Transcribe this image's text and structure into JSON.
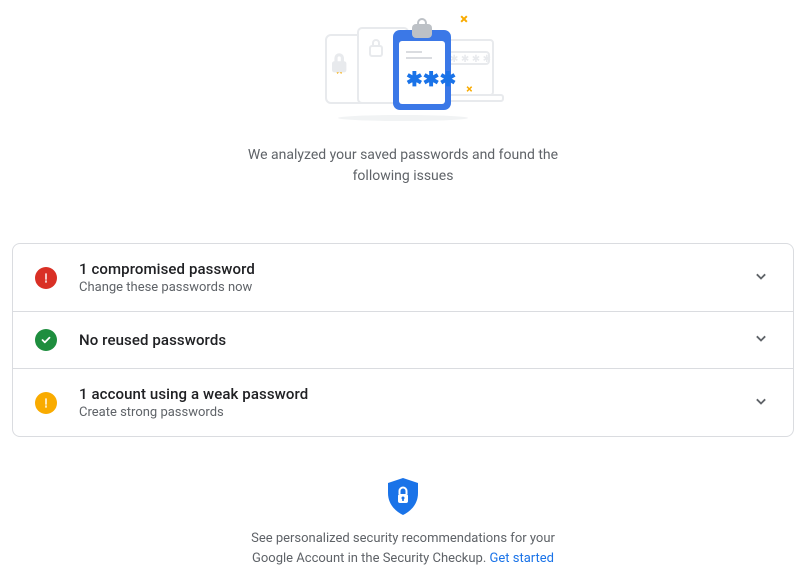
{
  "hero": {
    "text": "We analyzed your saved passwords and found the following issues"
  },
  "items": [
    {
      "title": "1 compromised password",
      "subtitle": "Change these passwords now",
      "status": "red"
    },
    {
      "title": "No reused passwords",
      "subtitle": "",
      "status": "green"
    },
    {
      "title": "1 account using a weak password",
      "subtitle": "Create strong passwords",
      "status": "yellow"
    }
  ],
  "footer": {
    "text": "See personalized security recommendations for your Google Account in the Security Checkup. ",
    "link": "Get started"
  }
}
